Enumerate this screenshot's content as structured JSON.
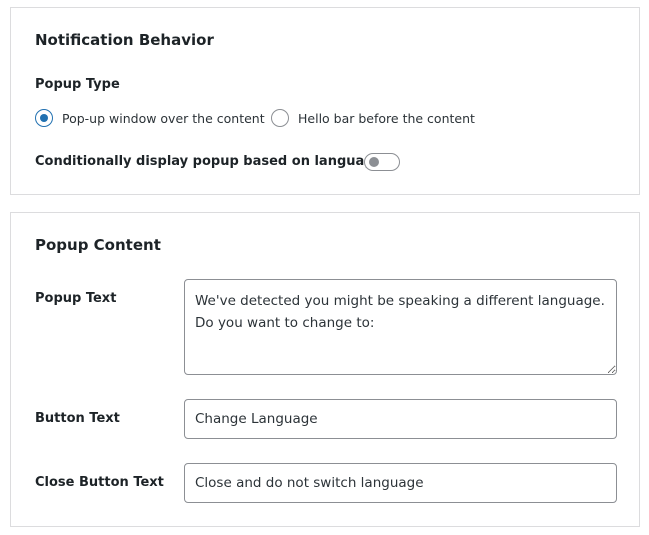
{
  "notification_behavior": {
    "title": "Notification Behavior",
    "popup_type": {
      "label": "Popup Type",
      "options": [
        {
          "label": "Pop-up window over the content",
          "checked": true
        },
        {
          "label": "Hello bar before the content",
          "checked": false
        }
      ]
    },
    "conditional": {
      "label": "Conditionally display popup based on language",
      "enabled": false
    }
  },
  "popup_content": {
    "title": "Popup Content",
    "popup_text": {
      "label": "Popup Text",
      "value": "We've detected you might be speaking a different language. Do you want to change to:"
    },
    "button_text": {
      "label": "Button Text",
      "value": "Change Language"
    },
    "close_button_text": {
      "label": "Close Button Text",
      "value": "Close and do not switch language"
    }
  },
  "colors": {
    "accent": "#2271b1",
    "border": "#dcdcde",
    "input_border": "#8c8f94"
  }
}
